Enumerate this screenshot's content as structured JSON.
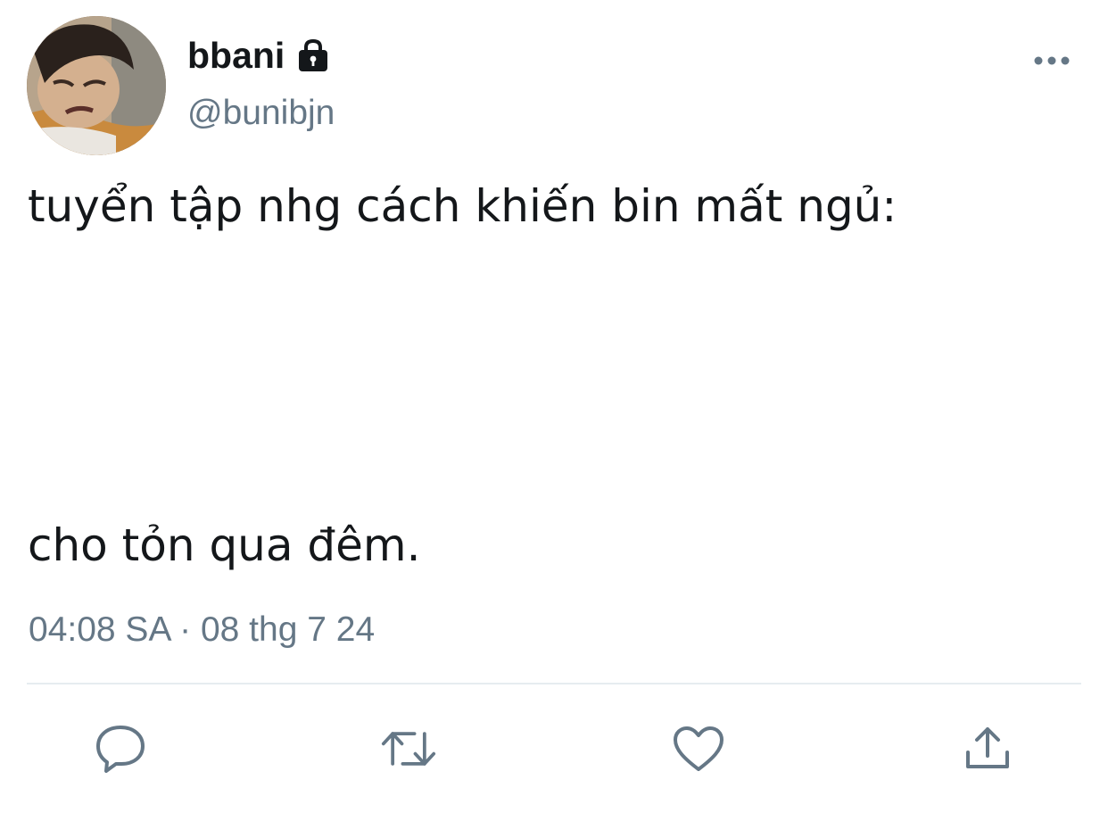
{
  "user": {
    "display_name": "bbani",
    "handle": "@bunibjn",
    "protected_icon": "lock-icon",
    "avatar_icon": "profile-photo"
  },
  "menu": {
    "icon": "more-horizontal-icon"
  },
  "tweet": {
    "line1": "tuyển tập nhg cách khiến bin mất ngủ:",
    "line2": "cho tỏn qua đêm.",
    "timestamp": "04:08 SA · 08 thg 7 24"
  },
  "actions": [
    {
      "icon": "reply-icon"
    },
    {
      "icon": "retweet-icon"
    },
    {
      "icon": "like-icon"
    },
    {
      "icon": "share-icon"
    }
  ],
  "colors": {
    "text_primary": "#14171a",
    "text_secondary": "#657786",
    "icon": "#657786",
    "divider": "#e6ecf0"
  }
}
